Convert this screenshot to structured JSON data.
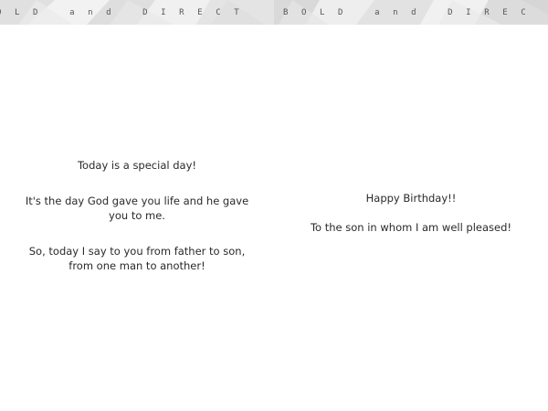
{
  "card": {
    "banner_text_left": "OLD and DIRECT",
    "banner_text_right": "BOLD and DIREC",
    "left_page": {
      "line1": "Today is a special day!",
      "line2": "It's the day God gave you life and he gave you to me.",
      "line3": "So, today I say to you from father to son, from one man to another!"
    },
    "right_page": {
      "line1": "Happy Birthday!!",
      "line2": "To the son in whom I am well pleased!"
    }
  }
}
